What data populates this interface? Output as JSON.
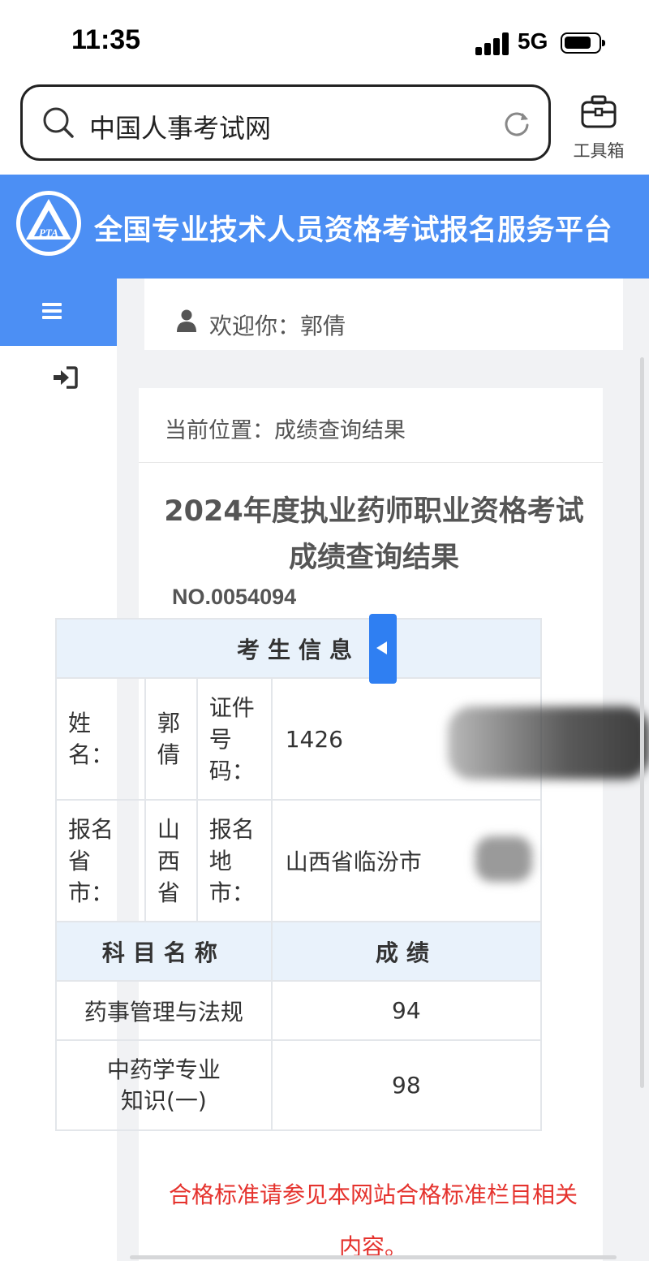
{
  "status_bar": {
    "time": "11:35",
    "network": "5G"
  },
  "browser": {
    "search_text": "中国人事考试网",
    "toolbox_label": "工具箱"
  },
  "header": {
    "title": "全国专业技术人员资格考试报名服务平台"
  },
  "welcome": {
    "text": "欢迎你：郭倩"
  },
  "breadcrumb": {
    "text": "当前位置：成绩查询结果"
  },
  "result": {
    "title": "2024年度执业药师职业资格考试成绩查询结果",
    "number": "NO.0054094",
    "info_header": "考生信息",
    "name_label": "姓名：",
    "name_value": "郭倩",
    "id_label": "证件号码：",
    "id_value": "1426",
    "province_label": "报名省市：",
    "province_value": "山西省",
    "city_label": "报名地市：",
    "city_value": "山西省临汾市",
    "subject_header": "科目名称",
    "score_header": "成绩",
    "rows": [
      {
        "subject": "药事管理与法规",
        "score": "94"
      },
      {
        "subject": "中药学专业知识(一)",
        "score": "98"
      }
    ]
  },
  "notice": "合格标准请参见本网站合格标准栏目相关内容。",
  "colors": {
    "brand_blue": "#4c8ff4",
    "notice_red": "#e5322d",
    "table_header_bg": "#e9f2fb"
  },
  "icons": [
    "search-icon",
    "refresh-icon",
    "toolbox-icon",
    "pta-logo",
    "menu-icon",
    "login-icon",
    "user-icon",
    "collapse-arrow-icon"
  ]
}
